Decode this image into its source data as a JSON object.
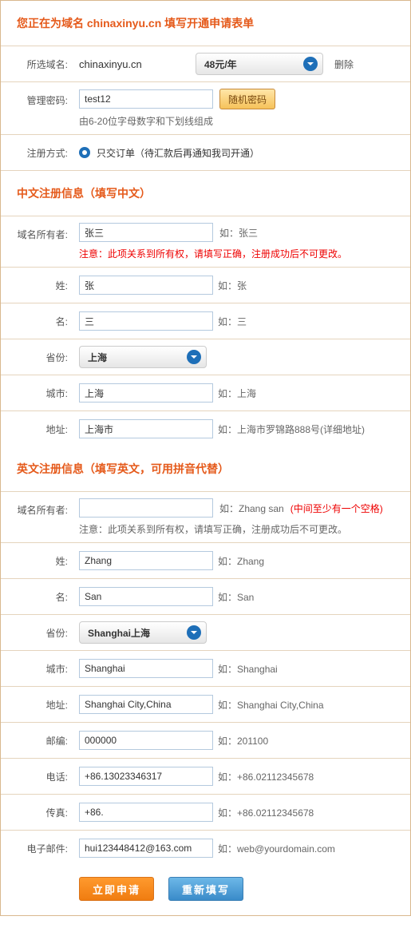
{
  "header": {
    "title": "您正在为域名 chinaxinyu.cn 填写开通申请表单"
  },
  "domain_row": {
    "label": "所选域名:",
    "name": "chinaxinyu.cn",
    "price": "48元/年",
    "delete": "删除"
  },
  "password_row": {
    "label": "管理密码:",
    "value": "test12",
    "random_btn": "随机密码",
    "note": "由6-20位字母数字和下划线组成"
  },
  "reg_method": {
    "label": "注册方式:",
    "text": "只交订单（待汇款后再通知我司开通）"
  },
  "cn_section": {
    "title": "中文注册信息（填写中文）",
    "rows": [
      {
        "label": "域名所有者:",
        "value": "张三",
        "hint": "如：张三",
        "note": "注意：此项关系到所有权，请填写正确，注册成功后不可更改。",
        "note_red": true
      },
      {
        "label": "姓:",
        "value": "张",
        "hint": "如：张"
      },
      {
        "label": "名:",
        "value": "三",
        "hint": "如：三"
      },
      {
        "label": "省份:",
        "type": "select",
        "value": "上海"
      },
      {
        "label": "城市:",
        "value": "上海",
        "hint": "如：上海"
      },
      {
        "label": "地址:",
        "value": "上海市",
        "hint": "如：上海市罗锦路888号(详细地址)"
      }
    ]
  },
  "en_section": {
    "title": "英文注册信息（填写英文，可用拼音代替）",
    "rows": [
      {
        "label": "域名所有者:",
        "value": "",
        "hint": "如：Zhang san ",
        "hint_extra": "(中间至少有一个空格)",
        "note": "注意：此项关系到所有权，请填写正确，注册成功后不可更改。",
        "note_red": false
      },
      {
        "label": "姓:",
        "value": "Zhang",
        "hint": "如：Zhang"
      },
      {
        "label": "名:",
        "value": "San",
        "hint": "如：San"
      },
      {
        "label": "省份:",
        "type": "select",
        "value": "Shanghai上海"
      },
      {
        "label": "城市:",
        "value": "Shanghai",
        "hint": "如：Shanghai"
      },
      {
        "label": "地址:",
        "value": "Shanghai City,China",
        "hint": "如：Shanghai City,China"
      },
      {
        "label": "邮编:",
        "value": "000000",
        "hint": "如：201100"
      },
      {
        "label": "电话:",
        "value": "+86.13023346317",
        "hint": "如：+86.02112345678"
      },
      {
        "label": "传真:",
        "value": "+86.",
        "hint": "如：+86.02112345678"
      },
      {
        "label": "电子邮件:",
        "value": "hui123448412@163.com",
        "hint": "如：web@yourdomain.com"
      }
    ]
  },
  "actions": {
    "submit": "立即申请",
    "reset": "重新填写"
  }
}
